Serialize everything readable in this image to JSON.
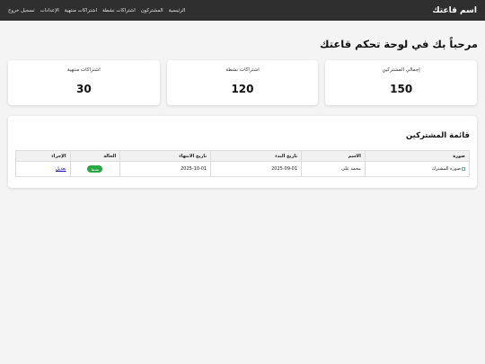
{
  "header": {
    "brand": "اسم قاعتك",
    "nav": [
      "الرئيسية",
      "المشتركون",
      "اشتراكات نشطة",
      "اشتراكات منتهية",
      "الإعدادات",
      "تسجيل خروج"
    ]
  },
  "page": {
    "title": "مرحباً بك في لوحة تحكم قاعتك"
  },
  "stats": [
    {
      "label": "إجمالي المشتركين",
      "value": "150"
    },
    {
      "label": "اشتراكات نشطة",
      "value": "120"
    },
    {
      "label": "اشتراكات منتهية",
      "value": "30"
    }
  ],
  "subscribers": {
    "title": "قائمة المشتركين",
    "columns": [
      "صورة",
      "الاسم",
      "تاريخ البدء",
      "تاريخ الانتهاء",
      "الحالة",
      "الإجراء"
    ],
    "rows": [
      {
        "photo_alt": "صورة المشترك",
        "name": "محمد علي",
        "start": "2025-09-01",
        "end": "2025-10-01",
        "status": "نشط",
        "action": "تعديل"
      }
    ]
  },
  "colors": {
    "topbar": "#2f2f2f",
    "status_active": "#28a745",
    "link": "#1a0dab"
  }
}
